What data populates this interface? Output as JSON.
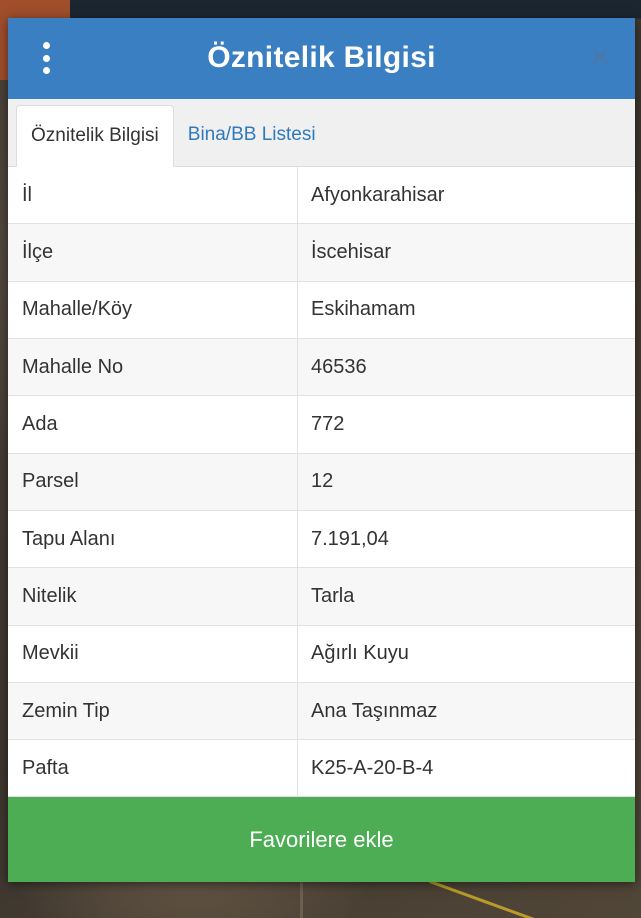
{
  "dialog": {
    "title": "Öznitelik Bilgisi",
    "close_label": "×"
  },
  "tabs": [
    {
      "label": "Öznitelik Bilgisi",
      "active": true
    },
    {
      "label": "Bina/BB Listesi",
      "active": false
    }
  ],
  "attributes": [
    {
      "key": "İl",
      "value": "Afyonkarahisar"
    },
    {
      "key": "İlçe",
      "value": "İscehisar"
    },
    {
      "key": "Mahalle/Köy",
      "value": "Eskihamam"
    },
    {
      "key": "Mahalle No",
      "value": "46536"
    },
    {
      "key": "Ada",
      "value": "772"
    },
    {
      "key": "Parsel",
      "value": "12"
    },
    {
      "key": "Tapu Alanı",
      "value": "7.191,04"
    },
    {
      "key": "Nitelik",
      "value": "Tarla"
    },
    {
      "key": "Mevkii",
      "value": "Ağırlı Kuyu"
    },
    {
      "key": "Zemin Tip",
      "value": "Ana Taşınmaz"
    },
    {
      "key": "Pafta",
      "value": "K25-A-20-B-4"
    }
  ],
  "footer": {
    "favorite_label": "Favorilere ekle"
  },
  "colors": {
    "header": "#3a7fc1",
    "footer": "#4cad55",
    "tab_link": "#2f79bd"
  },
  "icons": {
    "menu": "more-vertical-icon",
    "close": "close-icon"
  }
}
